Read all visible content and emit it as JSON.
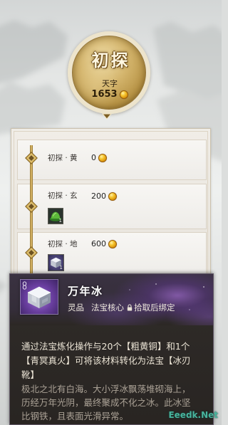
{
  "medallion": {
    "title": "初探",
    "subtitle": "天字",
    "points": "1653",
    "points_icon": "gold-coin-icon"
  },
  "tiers": [
    {
      "label": "初探 · 黄",
      "cost": "0",
      "cost_icon": "gold-coin-icon",
      "rewards": []
    },
    {
      "label": "初探 · 玄",
      "cost": "200",
      "cost_icon": "gold-coin-icon",
      "rewards": [
        {
          "icon": "green-hat-icon",
          "count": "1"
        }
      ]
    },
    {
      "label": "初探 · 地",
      "cost": "600",
      "cost_icon": "gold-coin-icon",
      "rewards": [
        {
          "icon": "ice-cube-icon",
          "count": "1"
        }
      ]
    }
  ],
  "tooltip": {
    "item_icon": "ice-cube-icon",
    "corner_icon": "link-icon",
    "item_name": "万年冰",
    "grade": "灵品",
    "category": "法宝核心",
    "bind_icon": "lock-icon",
    "bind": "拾取后绑定",
    "usage": "通过法宝炼化操作与20个【粗黄铜】和1个【青冥真火】可将该材料转化为法宝【冰刃靴】",
    "description": "极北之北有白海。大小浮冰飘荡堆砌海上，历经万年光阴，最终聚成不化之冰。此冰坚比钢铁，且表面光滑异常。"
  },
  "watermark": "Eeedk.Net",
  "colors": {
    "gold": "#c9a24a",
    "panel_bg": "#ebe7df",
    "row_bg": "#f3f1ed",
    "tooltip_bg": "#2c2825",
    "tooltip_purple": "#6a3fa0",
    "usage_text": "#ece5d6",
    "lore_text": "#aba296",
    "watermark": "#49b39d"
  }
}
